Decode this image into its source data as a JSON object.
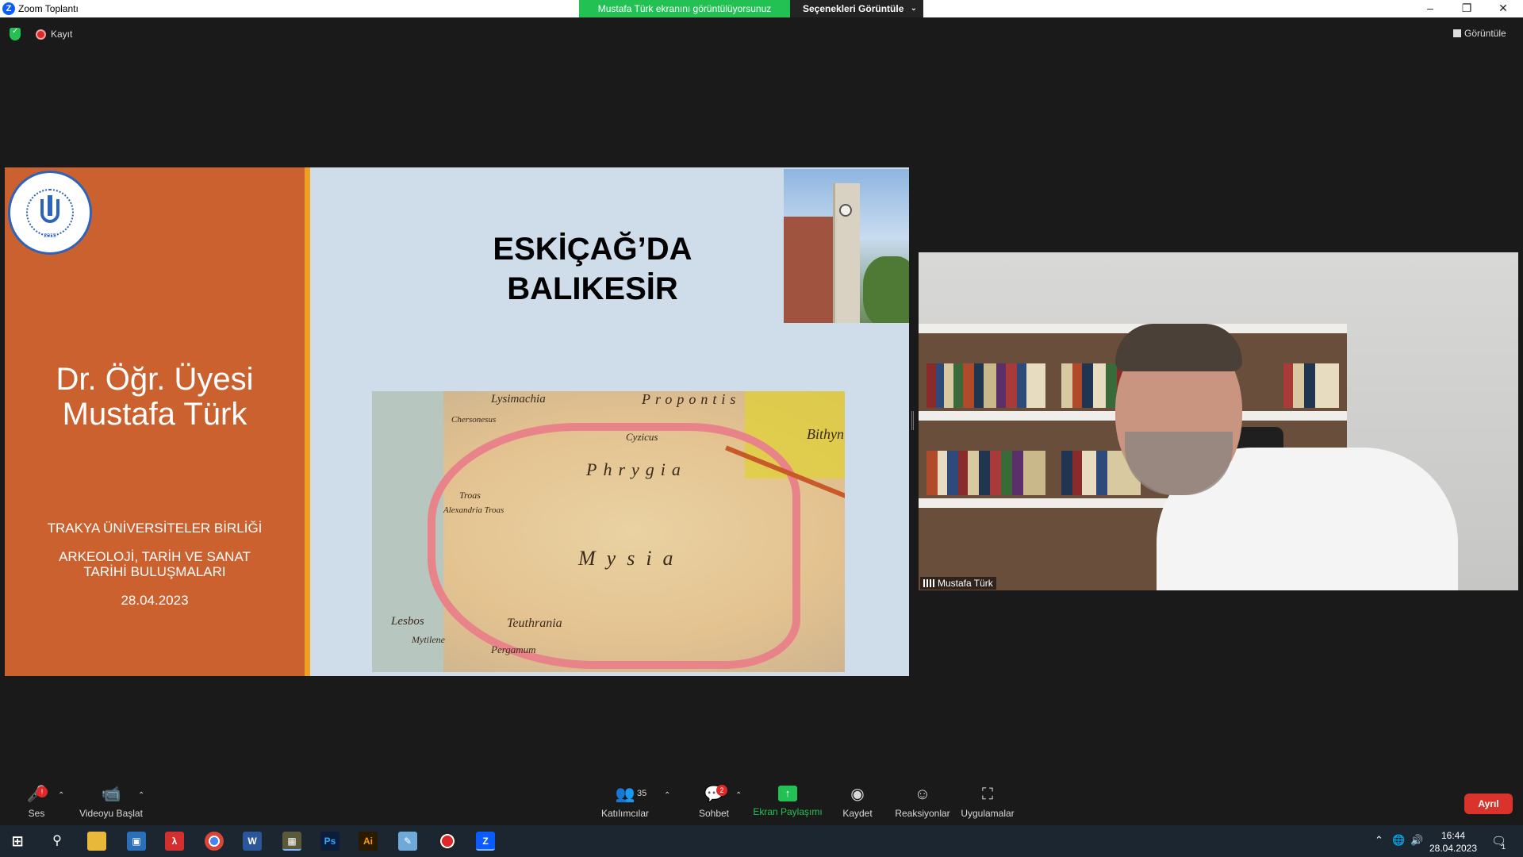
{
  "window": {
    "title": "Zoom Toplantı",
    "share_banner": "Mustafa Türk ekranını görüntülüyorsunuz",
    "view_options": "Seçenekleri Görüntüle"
  },
  "meeting": {
    "recording_label": "Kayıt",
    "view_label": "Görüntüle"
  },
  "slide": {
    "title_line1": "ESKİÇAĞ’DA",
    "title_line2": "BALIKESİR",
    "presenter_line1": "Dr. Öğr. Üyesi",
    "presenter_line2": "Mustafa Türk",
    "organization": "TRAKYA ÜNİVERSİTELER BİRLİĞİ",
    "department": "ARKEOLOJİ, TARİH VE SANAT TARİHİ BULUŞMALARI",
    "date": "28.04.2023",
    "logo_year": "2015",
    "map_labels": [
      "Lysimachia",
      "Chersonesus",
      "Propontis",
      "Cyzicus",
      "Phrygia",
      "Troas",
      "Alexandria Troas",
      "Lesbos",
      "Mytilene",
      "Mysia",
      "Teuthrania",
      "Pergamum",
      "Bithynia"
    ],
    "colors": {
      "left_panel": "#cc6130",
      "stripe": "#f0a020",
      "background": "#cfdcea"
    }
  },
  "participant": {
    "name": "Mustafa Türk"
  },
  "toolbar": {
    "audio_label": "Ses",
    "audio_badge": "!",
    "video_label": "Videoyu Başlat",
    "participants_label": "Katılımcılar",
    "participants_count": "35",
    "chat_label": "Sohbet",
    "chat_badge": "2",
    "share_label": "Ekran Paylaşımı",
    "record_label": "Kaydet",
    "reactions_label": "Reaksiyonlar",
    "apps_label": "Uygulamalar",
    "leave_label": "Ayrıl"
  },
  "taskbar": {
    "apps": [
      "windows-start",
      "search",
      "file-explorer",
      "screen-app",
      "acrobat",
      "chrome",
      "word",
      "ms-app",
      "photoshop",
      "illustrator",
      "paint",
      "recorder",
      "zoom"
    ],
    "time": "16:44",
    "date": "28.04.2023",
    "notifications": "1"
  }
}
